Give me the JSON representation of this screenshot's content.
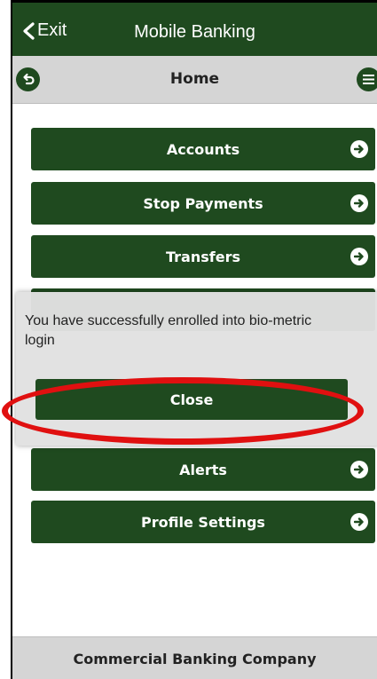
{
  "header": {
    "exit_label": "Exit",
    "title": "Mobile Banking"
  },
  "subheader": {
    "title": "Home"
  },
  "menu": {
    "items": [
      {
        "label": "Accounts"
      },
      {
        "label": "Stop Payments"
      },
      {
        "label": "Transfers"
      },
      {
        "label": "Alerts"
      },
      {
        "label": "Profile Settings"
      }
    ]
  },
  "dialog": {
    "message": "You have successfully enrolled into bio-metric login",
    "close_label": "Close"
  },
  "footer": {
    "company": "Commercial Banking Company"
  },
  "colors": {
    "brand_green": "#1f4a1f",
    "bar_gray": "#d5d5d5",
    "highlight_red": "#e01010"
  },
  "icons": {
    "exit": "chevron-left-icon",
    "back": "back-arrow-icon",
    "menu": "hamburger-menu-icon",
    "item_arrow": "arrow-right-icon"
  }
}
